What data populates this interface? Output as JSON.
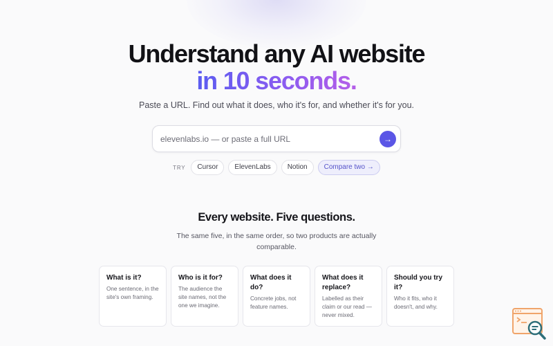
{
  "hero": {
    "title_line1": "Understand any AI website",
    "title_line2": "in 10 seconds.",
    "subtitle": "Paste a URL. Find out what it does, who it's for, and whether it's for you."
  },
  "search": {
    "placeholder": "elevenlabs.io — or paste a full URL",
    "value": "",
    "submit_icon": "arrow-right-icon"
  },
  "try": {
    "label": "TRY",
    "chips": [
      "Cursor",
      "ElevenLabs",
      "Notion"
    ],
    "compare_label": "Compare two →"
  },
  "section": {
    "title": "Every website. Five questions.",
    "description": "The same five, in the same order, so two products are actually comparable."
  },
  "cards": [
    {
      "title": "What is it?",
      "body": "One sentence, in the site's own framing."
    },
    {
      "title": "Who is it for?",
      "body": "The audience the site names, not the one we imagine."
    },
    {
      "title": "What does it do?",
      "body": "Concrete jobs, not feature names."
    },
    {
      "title": "What does it replace?",
      "body": "Labelled as their claim or our read — never mixed."
    },
    {
      "title": "Should you try it?",
      "body": "Who it fits, who it doesn't, and why."
    }
  ],
  "colors": {
    "accent": "#5b56e6",
    "gradient_start": "#5b5cf0",
    "gradient_end": "#b55ee8",
    "logo_orange": "#f0a46a",
    "logo_teal": "#2e6f7a"
  },
  "icons": {
    "corner_logo": "browser-magnifier-icon"
  }
}
